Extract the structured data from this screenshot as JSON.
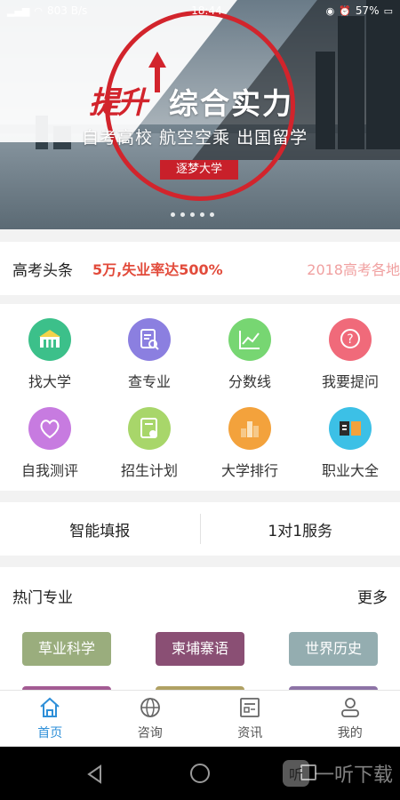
{
  "status_bar": {
    "network_speed": "803 B/s",
    "time": "18:44",
    "battery": "57%"
  },
  "banner": {
    "highlight_text": "提升",
    "main_text": "综合实力",
    "sub_text": "自考高校 航空空乘 出国留学",
    "tag_text": "逐梦大学",
    "slide_count": 5
  },
  "headline": {
    "label": "高考头条",
    "text": "5万,失业率达500%",
    "text_next": "2018高考各地"
  },
  "grid": {
    "items": [
      {
        "label": "找大学",
        "icon": "university-icon",
        "color": "#3cc08a"
      },
      {
        "label": "查专业",
        "icon": "major-search-icon",
        "color": "#8b7fe0"
      },
      {
        "label": "分数线",
        "icon": "score-line-icon",
        "color": "#77d672"
      },
      {
        "label": "我要提问",
        "icon": "question-icon",
        "color": "#f06a7a"
      },
      {
        "label": "自我测评",
        "icon": "self-assessment-icon",
        "color": "#c77be0"
      },
      {
        "label": "招生计划",
        "icon": "enrollment-plan-icon",
        "color": "#a8d66a"
      },
      {
        "label": "大学排行",
        "icon": "ranking-icon",
        "color": "#f3a23c"
      },
      {
        "label": "职业大全",
        "icon": "career-book-icon",
        "color": "#3cc0e6"
      }
    ]
  },
  "service": {
    "smart_fill": "智能填报",
    "one_on_one": "1对1服务"
  },
  "majors": {
    "title": "热门专业",
    "more": "更多",
    "tags": [
      {
        "label": "草业科学",
        "color": "#9aad7d"
      },
      {
        "label": "柬埔寨语",
        "color": "#8a4f74"
      },
      {
        "label": "世界历史",
        "color": "#94adb0"
      }
    ],
    "tags_row2_colors": [
      "#a35b93",
      "#b0a163",
      "#8d73a6"
    ]
  },
  "tabbar": {
    "tabs": [
      {
        "label": "首页",
        "icon": "home-icon",
        "active": true
      },
      {
        "label": "咨询",
        "icon": "globe-icon",
        "active": false
      },
      {
        "label": "资讯",
        "icon": "news-icon",
        "active": false
      },
      {
        "label": "我的",
        "icon": "user-icon",
        "active": false
      }
    ]
  },
  "watermark": {
    "logo": "听",
    "text": "一听下载"
  }
}
